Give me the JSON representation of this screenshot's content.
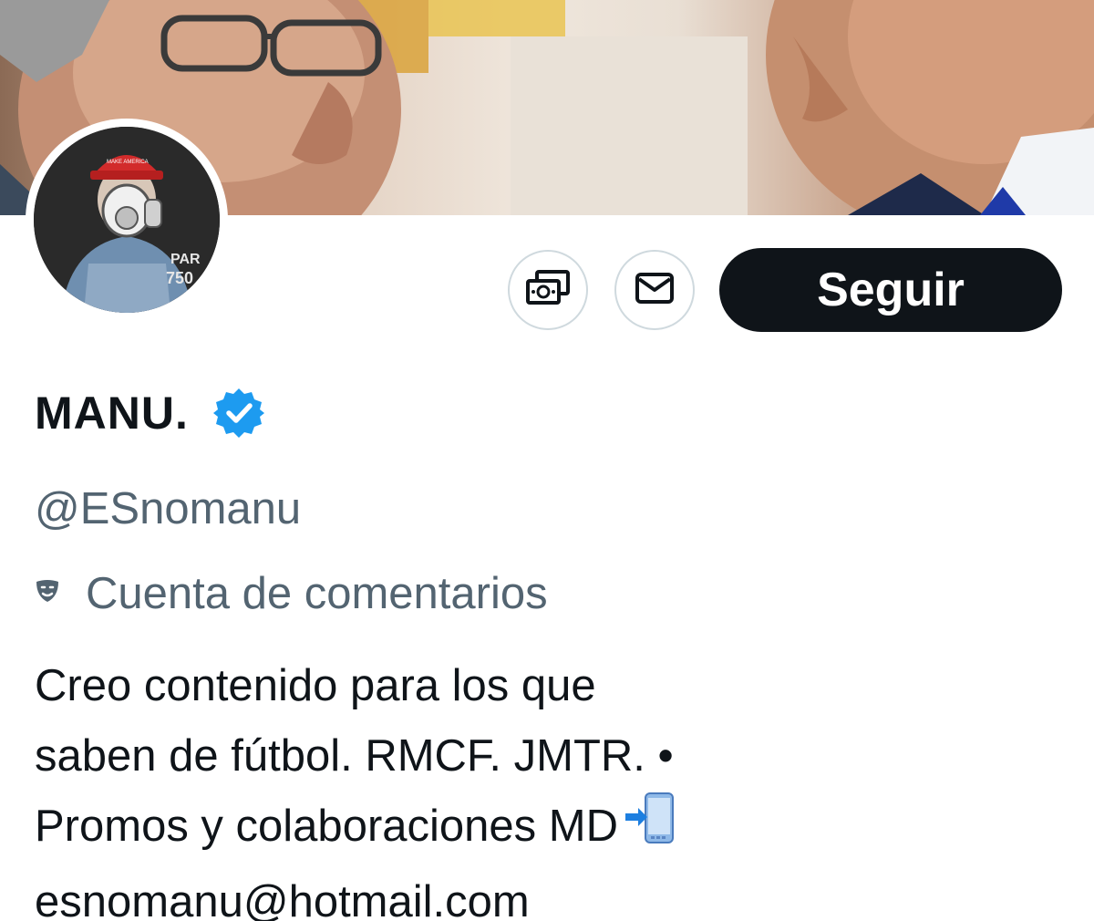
{
  "profile": {
    "display_name": "MANU.",
    "verified": true,
    "verified_icon": "verified-badge-icon",
    "handle": "@ESnomanu",
    "category_icon": "theater-masks-icon",
    "category": "Cuenta de comentarios",
    "bio_lines": [
      "Creo contenido para los que",
      "saben de fútbol. RMCF. JMTR. •",
      "Promos y colaboraciones MD",
      "esnomanu@hotmail.com"
    ],
    "bio_emoji_icon": "mobile-phone-arrow-icon"
  },
  "actions": {
    "tip_icon": "money-tip-icon",
    "message_icon": "envelope-icon",
    "follow_label": "Seguir"
  },
  "colors": {
    "primary_text": "#0f1419",
    "secondary_text": "#536471",
    "verified_blue": "#1d9bf0",
    "button_dark": "#0f1419",
    "button_border": "#cfd9de"
  }
}
